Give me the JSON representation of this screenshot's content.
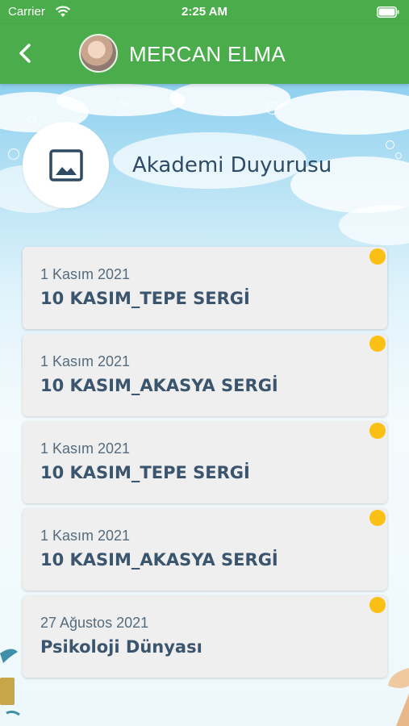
{
  "status_bar": {
    "carrier": "Carrier",
    "time": "2:25 AM"
  },
  "nav": {
    "title": "MERCAN ELMA"
  },
  "header": {
    "title": "Akademi Duyurusu"
  },
  "announcements": [
    {
      "date": "1 Kasım 2021",
      "title": "10 KASIM_TEPE SERGİ",
      "unread": true
    },
    {
      "date": "1 Kasım 2021",
      "title": "10 KASIM_AKASYA SERGİ",
      "unread": true
    },
    {
      "date": "1 Kasım 2021",
      "title": "10 KASIM_TEPE SERGİ",
      "unread": true
    },
    {
      "date": "1 Kasım 2021",
      "title": "10 KASIM_AKASYA SERGİ",
      "unread": true
    },
    {
      "date": "27 Ağustos 2021",
      "title": "Psikoloji Dünyası",
      "unread": true
    }
  ],
  "colors": {
    "nav_green": "#4aac4a",
    "unread_dot": "#fcbf13",
    "title_text": "#2f4a63"
  }
}
